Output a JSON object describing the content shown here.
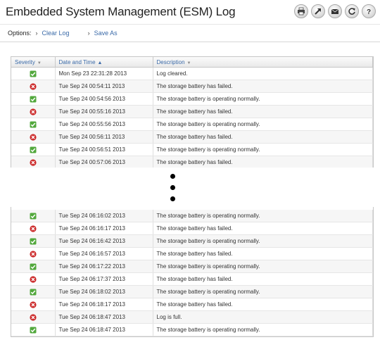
{
  "header": {
    "title": "Embedded System Management (ESM) Log"
  },
  "toolbar": {
    "buttons": [
      {
        "name": "print-icon"
      },
      {
        "name": "launch-icon"
      },
      {
        "name": "email-icon"
      },
      {
        "name": "refresh-icon"
      },
      {
        "name": "help-icon"
      }
    ]
  },
  "options": {
    "label": "Options:",
    "clear_log": "Clear Log",
    "save_as": "Save As"
  },
  "table": {
    "columns": {
      "severity": "Severity",
      "date": "Date and Time",
      "description": "Description"
    },
    "rows_top": [
      {
        "severity": "ok",
        "date": "Mon Sep 23 22:31:28 2013",
        "description": "Log cleared."
      },
      {
        "severity": "critical",
        "date": "Tue Sep 24 00:54:11 2013",
        "description": "The storage battery has failed."
      },
      {
        "severity": "ok",
        "date": "Tue Sep 24 00:54:56 2013",
        "description": "The storage battery is operating normally."
      },
      {
        "severity": "critical",
        "date": "Tue Sep 24 00:55:16 2013",
        "description": "The storage battery has failed."
      },
      {
        "severity": "ok",
        "date": "Tue Sep 24 00:55:56 2013",
        "description": "The storage battery is operating normally."
      },
      {
        "severity": "critical",
        "date": "Tue Sep 24 00:56:11 2013",
        "description": "The storage battery has failed."
      },
      {
        "severity": "ok",
        "date": "Tue Sep 24 00:56:51 2013",
        "description": "The storage battery is operating normally."
      },
      {
        "severity": "critical",
        "date": "Tue Sep 24 00:57:06 2013",
        "description": "The storage battery has failed."
      }
    ],
    "rows_bottom": [
      {
        "severity": "ok",
        "date": "Tue Sep 24 06:16:02 2013",
        "description": "The storage battery is operating normally."
      },
      {
        "severity": "critical",
        "date": "Tue Sep 24 06:16:17 2013",
        "description": "The storage battery has failed."
      },
      {
        "severity": "ok",
        "date": "Tue Sep 24 06:16:42 2013",
        "description": "The storage battery is operating normally."
      },
      {
        "severity": "critical",
        "date": "Tue Sep 24 06:16:57 2013",
        "description": "The storage battery has failed."
      },
      {
        "severity": "ok",
        "date": "Tue Sep 24 06:17:22 2013",
        "description": "The storage battery is operating normally."
      },
      {
        "severity": "critical",
        "date": "Tue Sep 24 06:17:37 2013",
        "description": "The storage battery has failed."
      },
      {
        "severity": "ok",
        "date": "Tue Sep 24 06:18:02 2013",
        "description": "The storage battery is operating normally."
      },
      {
        "severity": "critical",
        "date": "Tue Sep 24 06:18:17 2013",
        "description": "The storage battery has failed."
      },
      {
        "severity": "critical",
        "date": "Tue Sep 24 06:18:47 2013",
        "description": "Log is full."
      },
      {
        "severity": "ok",
        "date": "Tue Sep 24 06:18:47 2013",
        "description": "The storage battery is operating normally."
      }
    ]
  },
  "colors": {
    "ok": "#52a83c",
    "critical": "#cc2b2b",
    "link": "#3a6aa8"
  }
}
